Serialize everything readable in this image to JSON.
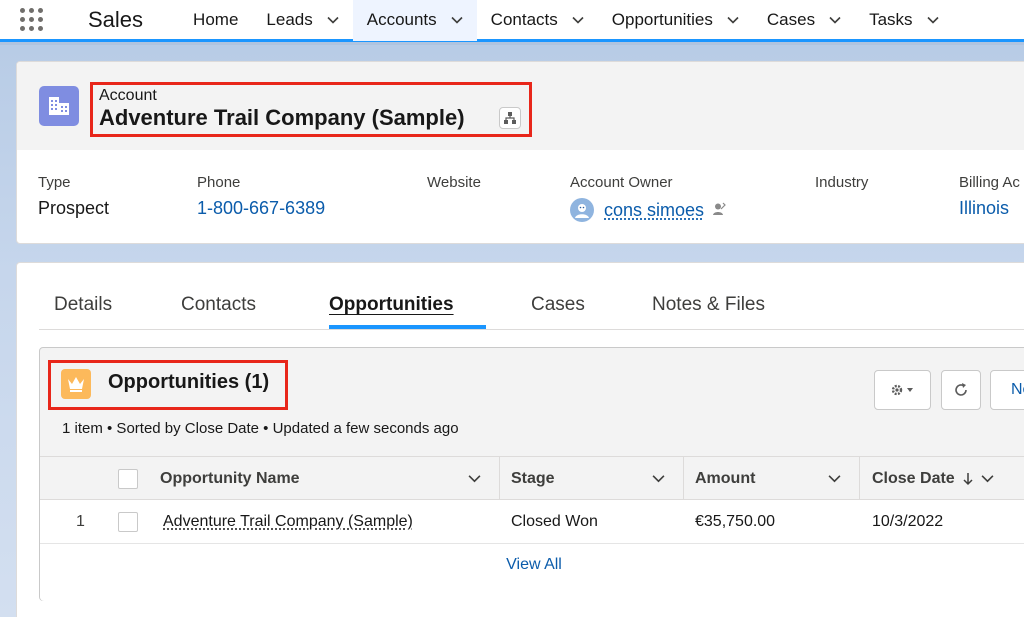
{
  "nav": {
    "app_name": "Sales",
    "items": [
      {
        "label": "Home",
        "has_menu": false
      },
      {
        "label": "Leads",
        "has_menu": true
      },
      {
        "label": "Accounts",
        "has_menu": true,
        "active": true
      },
      {
        "label": "Contacts",
        "has_menu": true
      },
      {
        "label": "Opportunities",
        "has_menu": true
      },
      {
        "label": "Cases",
        "has_menu": true
      },
      {
        "label": "Tasks",
        "has_menu": true
      }
    ]
  },
  "record": {
    "object_label": "Account",
    "name": "Adventure Trail Company (Sample)",
    "fields": {
      "type": {
        "label": "Type",
        "value": "Prospect"
      },
      "phone": {
        "label": "Phone",
        "value": "1-800-667-6389"
      },
      "website": {
        "label": "Website",
        "value": ""
      },
      "owner": {
        "label": "Account Owner",
        "value": "cons simoes"
      },
      "industry": {
        "label": "Industry",
        "value": ""
      },
      "billing": {
        "label": "Billing Ac",
        "value": "Illinois"
      }
    }
  },
  "tabs": [
    {
      "label": "Details"
    },
    {
      "label": "Contacts"
    },
    {
      "label": "Opportunities",
      "active": true
    },
    {
      "label": "Cases"
    },
    {
      "label": "Notes & Files"
    }
  ],
  "related_list": {
    "title": "Opportunities (1)",
    "subtitle": "1 item • Sorted by Close Date • Updated a few seconds ago",
    "new_button_label": "Ne",
    "columns": {
      "name": "Opportunity Name",
      "stage": "Stage",
      "amount": "Amount",
      "close_date": "Close Date"
    },
    "rows": [
      {
        "num": "1",
        "name": "Adventure Trail Company (Sample)",
        "stage": "Closed Won",
        "amount": "€35,750.00",
        "close_date": "10/3/2022"
      }
    ],
    "view_all": "View All"
  },
  "colors": {
    "accent": "#1b96ff",
    "highlight_box": "#e8261a",
    "account_icon": "#7f8de1",
    "opportunity_icon": "#fcb95b",
    "link": "#0b5cab"
  },
  "icons": {
    "app_launcher": "waffle-icon",
    "account": "building-icon",
    "hierarchy": "hierarchy-icon",
    "opportunity": "crown-icon",
    "settings": "gear-icon",
    "refresh": "refresh-icon",
    "sort": "arrow-down-icon"
  }
}
